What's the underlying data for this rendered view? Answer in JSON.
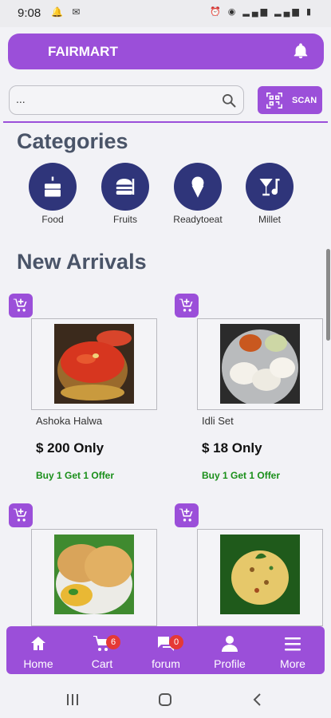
{
  "status_bar": {
    "time": "9:08"
  },
  "header": {
    "brand": "FAIRMART"
  },
  "search": {
    "placeholder": "...",
    "scan_label": "SCAN"
  },
  "categories": {
    "title": "Categories",
    "items": [
      {
        "label": "Food",
        "icon": "cake-icon"
      },
      {
        "label": "Fruits",
        "icon": "burger-icon"
      },
      {
        "label": "Readytoeat",
        "icon": "icecream-icon"
      },
      {
        "label": "Millet",
        "icon": "cocktail-icon"
      }
    ]
  },
  "new_arrivals": {
    "title": "New Arrivals",
    "products": [
      {
        "name": "Ashoka Halwa",
        "price": "$ 200 Only",
        "offer": "Buy 1 Get 1 Offer"
      },
      {
        "name": "Idli Set",
        "price": "$ 18 Only",
        "offer": "Buy 1 Get 1 Offer"
      }
    ]
  },
  "bottom_nav": {
    "items": [
      {
        "label": "Home",
        "icon": "home-icon"
      },
      {
        "label": "Cart",
        "icon": "cart-icon",
        "badge": "6"
      },
      {
        "label": "forum",
        "icon": "forum-icon",
        "badge": "0"
      },
      {
        "label": "Profile",
        "icon": "person-icon"
      },
      {
        "label": "More",
        "icon": "menu-icon"
      }
    ]
  },
  "colors": {
    "primary": "#9b4fd9",
    "category_circle": "#2f357a",
    "offer_green": "#1a8f1a",
    "badge_red": "#e53935"
  }
}
